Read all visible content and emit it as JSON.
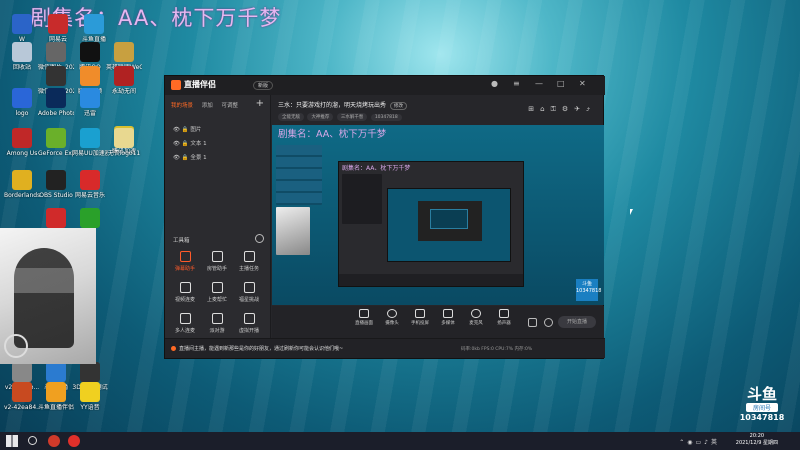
{
  "overlay_title": "剧集名：AA、枕下万千梦",
  "desktop_icons": [
    {
      "label": "W",
      "color": "#2b64c8"
    },
    {
      "label": "网易云",
      "color": "#c82b2b"
    },
    {
      "label": "斗鱼直播",
      "color": "#2b9bd8"
    },
    {
      "label": "回收站",
      "color": "#b8c8d8"
    },
    {
      "label": "微信图片_2021120...",
      "color": "#666"
    },
    {
      "label": "腾讯QQ",
      "color": "#111"
    },
    {
      "label": "英雄联盟WeGame版",
      "color": "#c8a040"
    },
    {
      "label": "微信图片_2021120...",
      "color": "#333"
    },
    {
      "label": "腾讯视频",
      "color": "#f08c2a"
    },
    {
      "label": "永劫无间",
      "color": "#b02222"
    },
    {
      "label": "logo",
      "color": "#2a66d8"
    },
    {
      "label": "Adobe Photosh...",
      "color": "#0a2a5a"
    },
    {
      "label": "迅雷",
      "color": "#2a8ae0"
    },
    {
      "label": "腾讯加速",
      "color": "#d8c030"
    },
    {
      "label": "Among Us",
      "color": "#c02828"
    },
    {
      "label": "GeForce Experience",
      "color": "#6ab02a"
    },
    {
      "label": "网易UU加速器",
      "color": "#1aa0d0"
    },
    {
      "label": "无畏logo11",
      "color": "#e8d890"
    },
    {
      "label": "Borderlands 2",
      "color": "#e0b020"
    },
    {
      "label": "OBS Studio",
      "color": "#222"
    },
    {
      "label": "网易云音乐",
      "color": "#d82a2a"
    },
    {
      "label": "",
      "color": "#d02a2a"
    },
    {
      "label": "",
      "color": "#2aa02a"
    },
    {
      "label": "v2-1db4b...",
      "color": "#888"
    },
    {
      "label": "斗鱼直播",
      "color": "#2b7bd0"
    },
    {
      "label": "3DMark测试",
      "color": "#333"
    },
    {
      "label": "v2-42ea84...",
      "color": "#c84a20"
    },
    {
      "label": "斗鱼直播伴侣",
      "color": "#f0a020"
    },
    {
      "label": "YY语音",
      "color": "#f0d020"
    }
  ],
  "app": {
    "logo_text": "直播伴侣",
    "version_label": "新版",
    "tabs": [
      "我的场景",
      "添加",
      "可调整"
    ],
    "scenes": [
      "图片",
      "文本 1",
      "全景 1"
    ],
    "tools_title": "工具箱",
    "tools": [
      {
        "label": "弹幕助手",
        "hot": true
      },
      {
        "label": "房管助手",
        "hot": false
      },
      {
        "label": "主播任务",
        "hot": false
      },
      {
        "label": "视频连麦",
        "hot": false
      },
      {
        "label": "上麦帮忙",
        "hot": false
      },
      {
        "label": "福星挑战",
        "hot": false
      },
      {
        "label": "多人连麦",
        "hot": false
      },
      {
        "label": "派对游",
        "hot": false
      },
      {
        "label": "虚拟开播",
        "hot": false
      }
    ],
    "room_title": "三水：只要游戏打的溜，明天烧烤玩出秀",
    "edit_label": "修改",
    "chips": [
      "全能无敌",
      "大神推荐",
      "三水解千愁",
      "10347818"
    ],
    "preview_title": "剧集名：AA、枕下万千梦",
    "bottom_tools": [
      "直播画面",
      "摄像头",
      "手机投屏",
      "多媒体",
      "麦克风",
      "扬声器"
    ],
    "start_label": "开始直播",
    "notice": "直播间主播，能遇到新那些是你的好朋友，通过刷新你可能会认识他们哦~",
    "stats": "码率:0kb   FPS:0   CPU:7%   内存:0%"
  },
  "douyu_mark": {
    "l1": "斗鱼",
    "l2": "房间号",
    "l3": "10347818"
  },
  "clock": {
    "time": "20:20",
    "date": "2021/12/9 星期四"
  }
}
